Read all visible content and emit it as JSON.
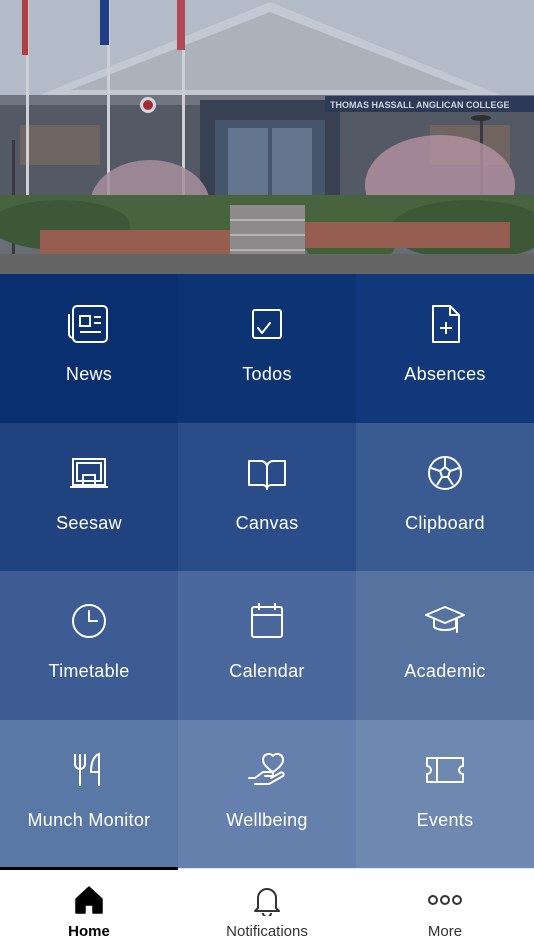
{
  "hero": {
    "sign_text": "THOMAS HASSALL ANGLICAN COLLEGE"
  },
  "tiles": [
    {
      "label": "News",
      "icon": "news-icon",
      "color": "#0a2f6e"
    },
    {
      "label": "Todos",
      "icon": "todos-icon",
      "color": "#0c3473"
    },
    {
      "label": "Absences",
      "icon": "absences-icon",
      "color": "#10387a"
    },
    {
      "label": "Seesaw",
      "icon": "seesaw-icon",
      "color": "#20427f"
    },
    {
      "label": "Canvas",
      "icon": "canvas-icon",
      "color": "#2a4c88"
    },
    {
      "label": "Clipboard",
      "icon": "clipboard-icon",
      "color": "#3a5a92"
    },
    {
      "label": "Timetable",
      "icon": "clock-icon",
      "color": "#3d5c93"
    },
    {
      "label": "Calendar",
      "icon": "calendar-icon",
      "color": "#4a689c"
    },
    {
      "label": "Academic",
      "icon": "graduation-cap-icon",
      "color": "#56739f"
    },
    {
      "label": "Munch Monitor",
      "icon": "utensils-icon",
      "color": "#5a78a6"
    },
    {
      "label": "Wellbeing",
      "icon": "helping-hand-heart-icon",
      "color": "#6580ac"
    },
    {
      "label": "Events",
      "icon": "ticket-icon",
      "color": "#6e88b0"
    }
  ],
  "tabbar": {
    "tabs": [
      {
        "label": "Home",
        "icon": "home-icon",
        "active": true
      },
      {
        "label": "Notifications",
        "icon": "bell-icon",
        "active": false
      },
      {
        "label": "More",
        "icon": "more-dots-icon",
        "active": false
      }
    ]
  }
}
